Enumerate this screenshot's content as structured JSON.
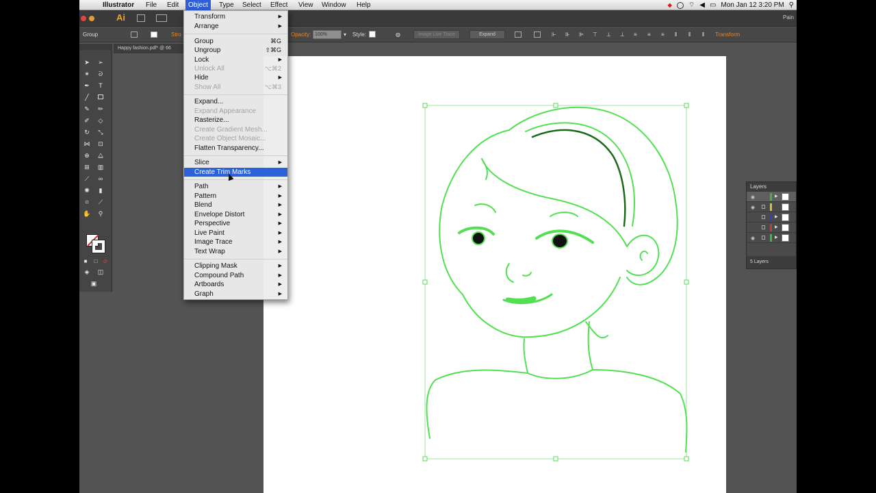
{
  "menubar": {
    "app_name": "Illustrator",
    "items": [
      "File",
      "Edit",
      "Object",
      "Type",
      "Select",
      "Effect",
      "View",
      "Window",
      "Help"
    ],
    "active": "Object",
    "clock": "Mon Jan 12  3:20 PM"
  },
  "appbar": {
    "logo": "Ai",
    "workspace": "Pain"
  },
  "controlbar": {
    "selection_type": "Group",
    "stroke_label": "Stro",
    "opacity_label": "Opacity:",
    "opacity_value": "100%",
    "style_label": "Style:",
    "image_trace_label": "Image Live Trace",
    "expand_label": "Expand",
    "transform_label": "Transform"
  },
  "document": {
    "tab_label": "Happy fashion.pdf* @ 66"
  },
  "object_menu": {
    "items": [
      {
        "label": "Transform",
        "submenu": true
      },
      {
        "label": "Arrange",
        "submenu": true
      },
      {
        "label": "Group",
        "shortcut": "⌘G"
      },
      {
        "label": "Ungroup",
        "shortcut": "⇧⌘G"
      },
      {
        "label": "Lock",
        "submenu": true
      },
      {
        "label": "Unlock All",
        "shortcut": "⌥⌘2",
        "disabled": true
      },
      {
        "label": "Hide",
        "submenu": true
      },
      {
        "label": "Show All",
        "shortcut": "⌥⌘3",
        "disabled": true
      },
      {
        "label": "Expand..."
      },
      {
        "label": "Expand Appearance",
        "disabled": true
      },
      {
        "label": "Rasterize..."
      },
      {
        "label": "Create Gradient Mesh...",
        "disabled": true
      },
      {
        "label": "Create Object Mosaic...",
        "disabled": true
      },
      {
        "label": "Flatten Transparency..."
      },
      {
        "label": "Slice",
        "submenu": true
      },
      {
        "label": "Create Trim Marks",
        "highlighted": true
      },
      {
        "label": "Path",
        "submenu": true
      },
      {
        "label": "Pattern",
        "submenu": true
      },
      {
        "label": "Blend",
        "submenu": true
      },
      {
        "label": "Envelope Distort",
        "submenu": true
      },
      {
        "label": "Perspective",
        "submenu": true
      },
      {
        "label": "Live Paint",
        "submenu": true
      },
      {
        "label": "Image Trace",
        "submenu": true
      },
      {
        "label": "Text Wrap",
        "submenu": true
      },
      {
        "label": "Clipping Mask",
        "submenu": true
      },
      {
        "label": "Compound Path",
        "submenu": true
      },
      {
        "label": "Artboards",
        "submenu": true
      },
      {
        "label": "Graph",
        "submenu": true
      }
    ]
  },
  "layers_panel": {
    "title": "Layers",
    "footer": "5 Layers",
    "layer_colors": [
      "#3cb84a",
      "#c9c93a",
      "#3a3acd",
      "#c93a3a",
      "#3cb84a"
    ]
  },
  "colors": {
    "selection_green": "#52e052",
    "menu_highlight": "#2a62d9",
    "accent_orange": "#e2872b"
  }
}
